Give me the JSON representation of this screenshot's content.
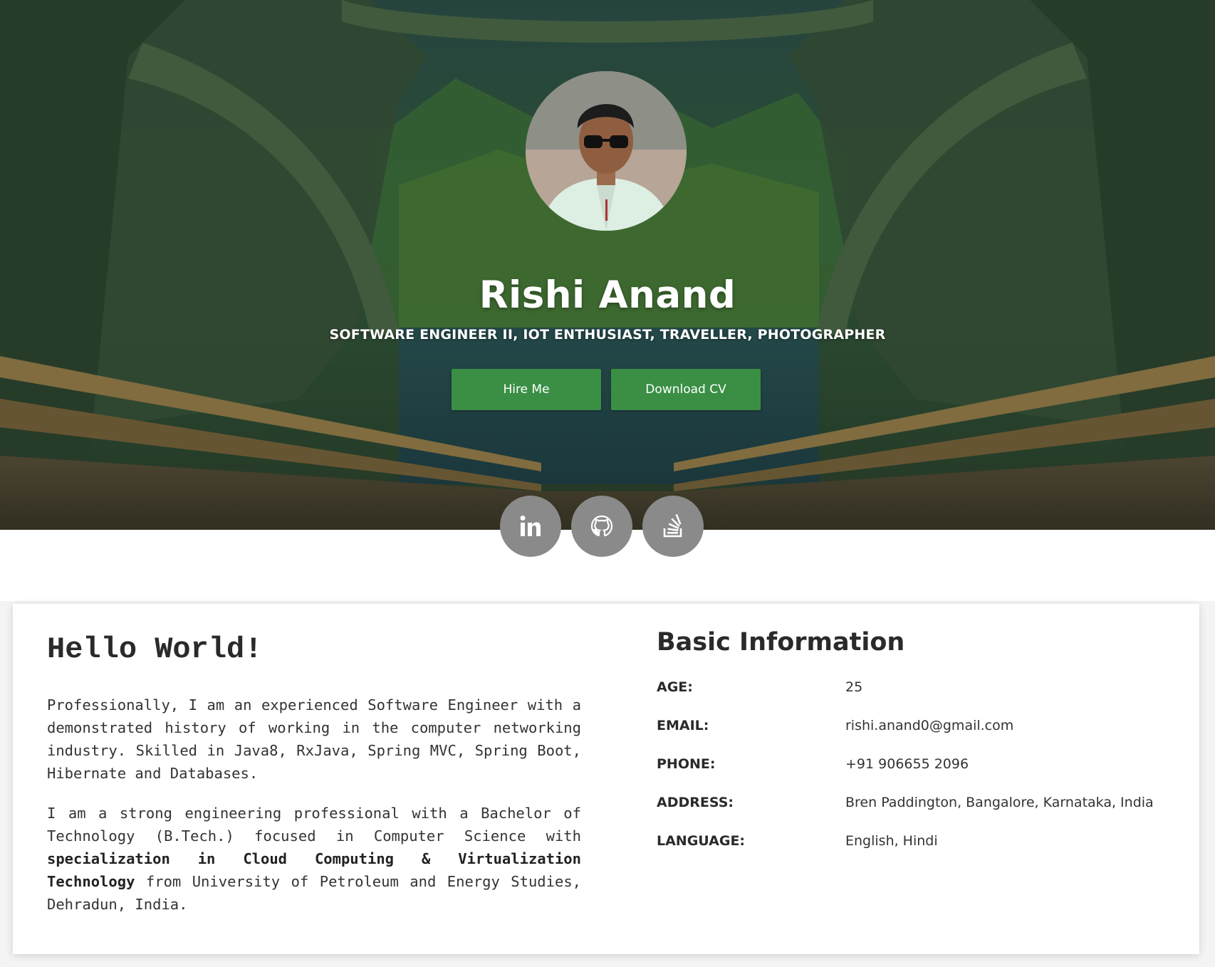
{
  "hero": {
    "name": "Rishi Anand",
    "subtitle": "SOFTWARE ENGINEER II, IOT ENTHUSIAST, TRAVELLER, PHOTOGRAPHER",
    "hire_label": "Hire Me",
    "cv_label": "Download CV",
    "button_color": "#3a8f45"
  },
  "social": [
    {
      "icon": "linkedin-icon"
    },
    {
      "icon": "github-icon"
    },
    {
      "icon": "stackoverflow-icon"
    }
  ],
  "about": {
    "heading": "Hello World!",
    "p1": "Professionally, I am an experienced Software Engineer with a demonstrated history of working in the computer networking industry. Skilled in Java8, RxJava, Spring MVC, Spring Boot, Hibernate and Databases.",
    "p2_start": "I am a strong engineering professional with a Bachelor of Technology (B.Tech.) focused in Computer Science with",
    "p2_bold": "specialization in Cloud Computing & Virtualization Technology",
    "p2_end": "from University of Petroleum and Energy Studies, Dehradun, India."
  },
  "info": {
    "title": "Basic Information",
    "rows": [
      {
        "label": "AGE:",
        "value": "25"
      },
      {
        "label": "EMAIL:",
        "value": "rishi.anand0@gmail.com"
      },
      {
        "label": "PHONE:",
        "value": "+91 906655 2096"
      },
      {
        "label": "ADDRESS:",
        "value": "Bren Paddington, Bangalore, Karnataka, India"
      },
      {
        "label": "LANGUAGE:",
        "value": "English, Hindi"
      }
    ]
  }
}
